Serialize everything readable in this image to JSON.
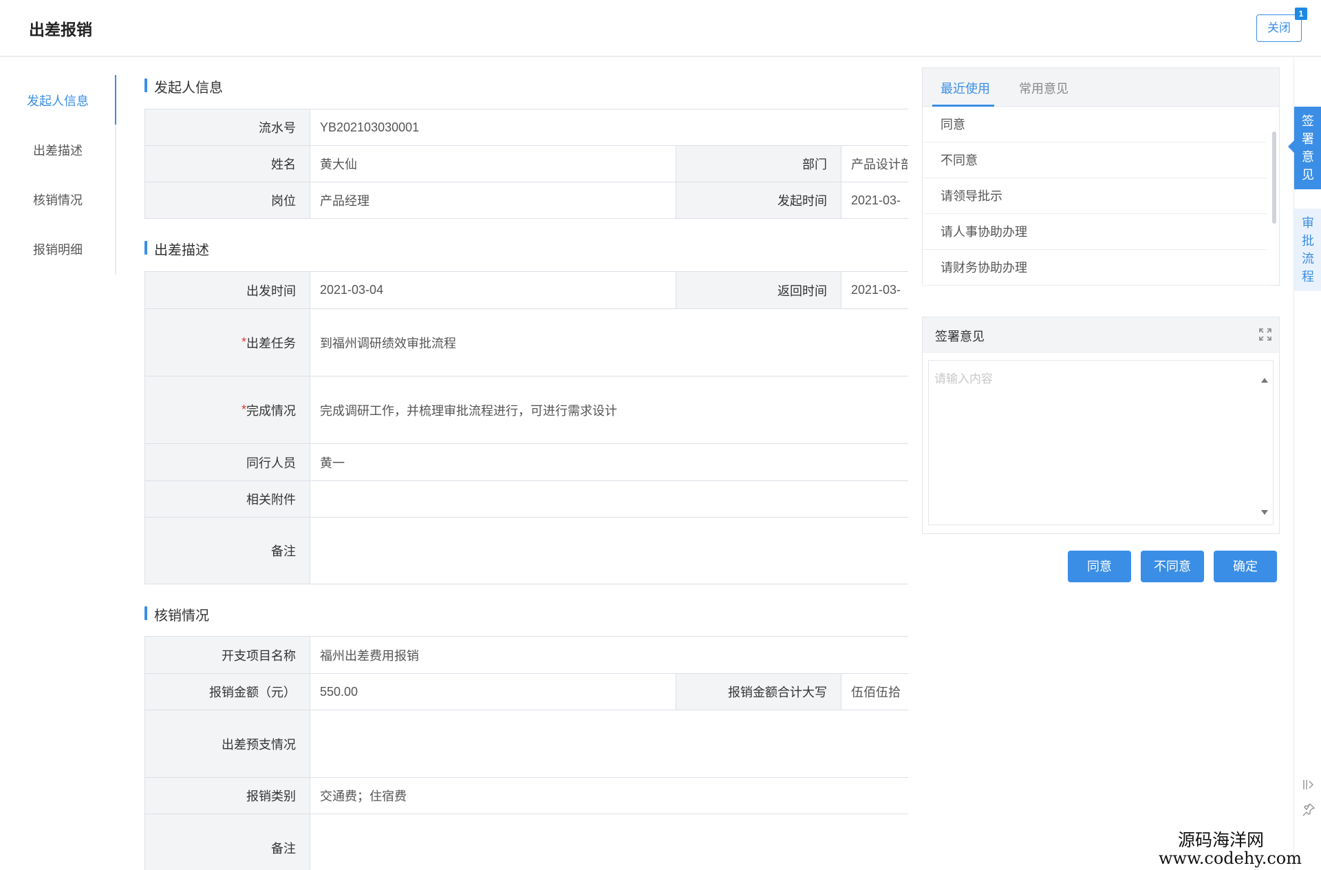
{
  "header": {
    "title": "出差报销",
    "close_label": "关闭",
    "close_badge": "1"
  },
  "left_nav": {
    "items": [
      {
        "label": "发起人信息",
        "active": true
      },
      {
        "label": "出差描述",
        "active": false
      },
      {
        "label": "核销情况",
        "active": false
      },
      {
        "label": "报销明细",
        "active": false
      }
    ]
  },
  "sections": {
    "initiator": {
      "title": "发起人信息",
      "serial_label": "流水号",
      "serial_value": "YB202103030001",
      "name_label": "姓名",
      "name_value": "黄大仙",
      "dept_label": "部门",
      "dept_value": "产品设计部",
      "post_label": "岗位",
      "post_value": "产品经理",
      "start_label": "发起时间",
      "start_value": "2021-03-"
    },
    "trip": {
      "title": "出差描述",
      "depart_label": "出发时间",
      "depart_value": "2021-03-04",
      "return_label": "返回时间",
      "return_value": "2021-03-",
      "task_label": "出差任务",
      "task_value": "到福州调研绩效审批流程",
      "done_label": "完成情况",
      "done_value": "完成调研工作，并梳理审批流程进行，可进行需求设计",
      "companion_label": "同行人员",
      "companion_value": "黄一",
      "attach_label": "相关附件",
      "attach_value": "",
      "remark_label": "备注",
      "remark_value": ""
    },
    "verify": {
      "title": "核销情况",
      "project_label": "开支项目名称",
      "project_value": "福州出差费用报销",
      "amount_label": "报销金额（元）",
      "amount_value": "550.00",
      "amount_cn_label": "报销金额合计大写",
      "amount_cn_value": "伍佰伍拾",
      "advance_label": "出差预支情况",
      "advance_value": "",
      "type_label": "报销类别",
      "type_value": "交通费；住宿费",
      "remark_label": "备注",
      "remark_value": ""
    }
  },
  "opinion_panel": {
    "tabs": [
      "最近使用",
      "常用意见"
    ],
    "items": [
      "同意",
      "不同意",
      "请领导批示",
      "请人事协助办理",
      "请财务协助办理"
    ],
    "sign_title": "签署意见",
    "sign_placeholder": "请输入内容",
    "buttons": {
      "agree": "同意",
      "disagree": "不同意",
      "confirm": "确定"
    }
  },
  "vertical_tabs": {
    "sign": "签署意见",
    "flow": "审批流程"
  },
  "watermark": {
    "name": "源码海洋网",
    "url": "www.codehy.com"
  },
  "colors": {
    "accent": "#3a8ee6",
    "label_bg": "#f3f4f6",
    "required": "#e53935"
  }
}
